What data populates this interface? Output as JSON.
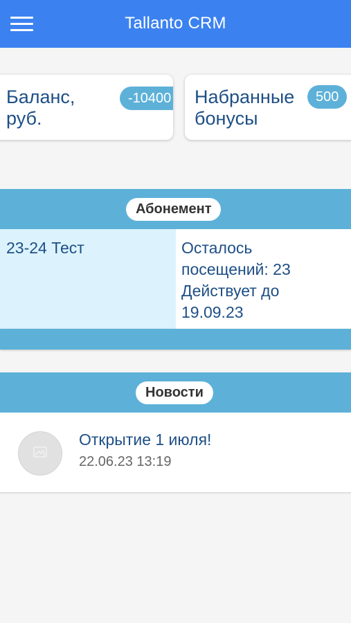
{
  "header": {
    "title": "Tallanto CRM",
    "menu_icon": "hamburger-menu-icon"
  },
  "cards": {
    "balance": {
      "label_line1": "Баланс,",
      "label_line2": "руб.",
      "value": "-10400"
    },
    "bonus": {
      "label_line1": "Набранные",
      "label_line2": "бонусы",
      "value": "500"
    }
  },
  "subscription": {
    "header": "Абонемент",
    "name": "23-24 Тест",
    "line1": "Осталось",
    "line2": "посещений: 23",
    "line3": "Действует до",
    "line4": "19.09.23"
  },
  "news": {
    "header": "Новости",
    "items": [
      {
        "title": "Открытие 1 июля!",
        "date": "22.06.23 13:19",
        "thumbnail_icon": "image-placeholder-icon"
      }
    ]
  },
  "colors": {
    "appbar": "#3b82f0",
    "accent": "#5db1d8",
    "text": "#1e4f86"
  }
}
